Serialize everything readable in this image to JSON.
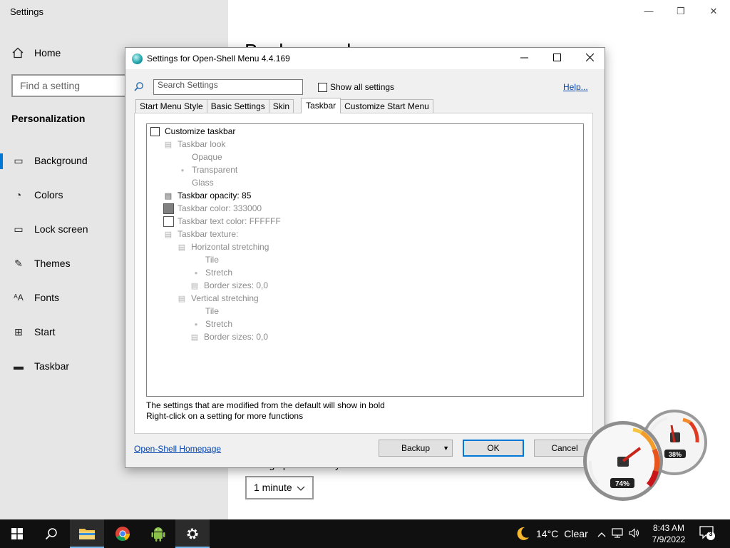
{
  "settings_app": {
    "title": "Settings",
    "minimize": "—",
    "restore": "❐",
    "close": "✕",
    "home_label": "Home",
    "search_placeholder": "Find a setting",
    "section_heading": "Personalization",
    "nav_items": [
      {
        "label": "Background",
        "icon": "image-icon"
      },
      {
        "label": "Colors",
        "icon": "palette-icon"
      },
      {
        "label": "Lock screen",
        "icon": "lock-screen-icon"
      },
      {
        "label": "Themes",
        "icon": "themes-icon"
      },
      {
        "label": "Fonts",
        "icon": "fonts-icon"
      },
      {
        "label": "Start",
        "icon": "start-icon"
      },
      {
        "label": "Taskbar",
        "icon": "taskbar-icon"
      }
    ],
    "page_heading": "Background",
    "change_picture_label": "Change picture every",
    "interval_value": "1 minute"
  },
  "dialog": {
    "title": "Settings for Open-Shell Menu 4.4.169",
    "search_placeholder": "Search Settings",
    "show_all_label": "Show all settings",
    "help_label": "Help...",
    "tabs": [
      "Start Menu Style",
      "Basic Settings",
      "Skin",
      "Taskbar",
      "Customize Start Menu"
    ],
    "active_tab": "Taskbar",
    "tree": {
      "customize_taskbar": "Customize taskbar",
      "taskbar_look": "Taskbar look",
      "opaque": "Opaque",
      "transparent": "Transparent",
      "glass": "Glass",
      "taskbar_opacity": "Taskbar opacity: 85",
      "taskbar_color": "Taskbar color: 333000",
      "taskbar_text_color": "Taskbar text color: FFFFFF",
      "taskbar_texture": "Taskbar texture:",
      "horizontal_stretching": "Horizontal stretching",
      "h_tile": "Tile",
      "h_stretch": "Stretch",
      "h_border": "Border sizes: 0,0",
      "vertical_stretching": "Vertical stretching",
      "v_tile": "Tile",
      "v_stretch": "Stretch",
      "v_border": "Border sizes: 0,0"
    },
    "note_bold": "The settings that are modified from the default will show in bold",
    "note_rightclick": "Right-click on a setting for more functions",
    "homepage_link": "Open-Shell Homepage",
    "backup_label": "Backup",
    "ok_label": "OK",
    "cancel_label": "Cancel",
    "taskbar_color_hex": "#808080"
  },
  "gadget": {
    "cpu_percent": "74%",
    "memory_percent": "38%"
  },
  "taskbar": {
    "apps": [
      "start-icon",
      "search-icon",
      "file-explorer-icon",
      "chrome-icon",
      "android-icon",
      "settings-gear-icon"
    ],
    "weather_temp": "14°C",
    "weather_condition": "Clear",
    "time": "8:43 AM",
    "date": "7/9/2022",
    "notification_count": "3"
  }
}
